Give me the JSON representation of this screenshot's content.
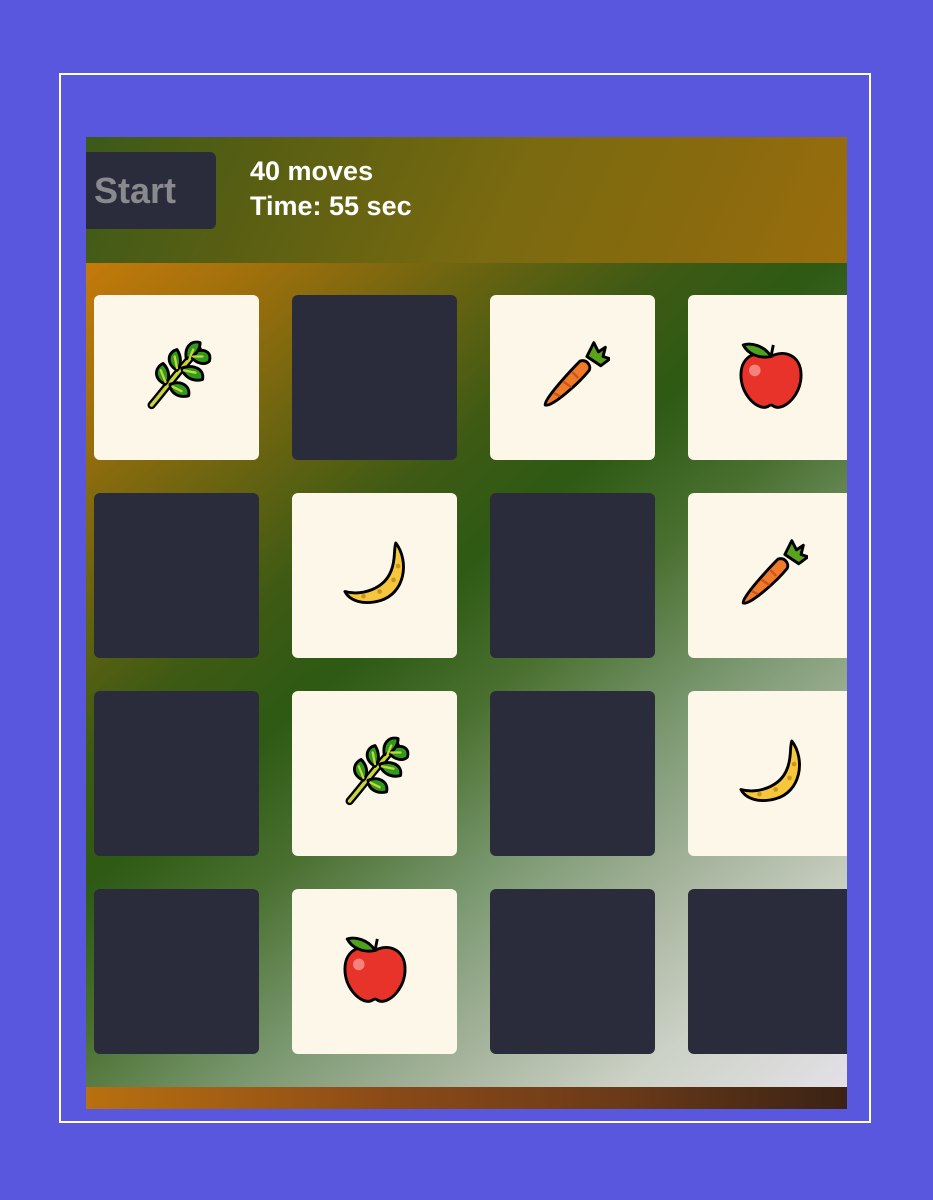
{
  "controls": {
    "start_label": "Start"
  },
  "stats": {
    "moves": "40 moves",
    "time": "Time: 55 sec"
  },
  "board": {
    "rows": 4,
    "cols": 4,
    "cards": [
      {
        "state": "up",
        "icon": "leafy-green-icon"
      },
      {
        "state": "down",
        "icon": ""
      },
      {
        "state": "up",
        "icon": "carrot-icon"
      },
      {
        "state": "up",
        "icon": "apple-icon"
      },
      {
        "state": "down",
        "icon": ""
      },
      {
        "state": "up",
        "icon": "banana-icon"
      },
      {
        "state": "down",
        "icon": ""
      },
      {
        "state": "up",
        "icon": "carrot-icon"
      },
      {
        "state": "down",
        "icon": ""
      },
      {
        "state": "up",
        "icon": "leafy-green-icon"
      },
      {
        "state": "down",
        "icon": ""
      },
      {
        "state": "up",
        "icon": "banana-icon"
      },
      {
        "state": "down",
        "icon": ""
      },
      {
        "state": "up",
        "icon": "apple-icon"
      },
      {
        "state": "down",
        "icon": ""
      },
      {
        "state": "down",
        "icon": ""
      }
    ]
  },
  "colors": {
    "page_background": "#5957dd",
    "card_back": "#2a2b3b",
    "card_face": "#fcf7e8"
  }
}
